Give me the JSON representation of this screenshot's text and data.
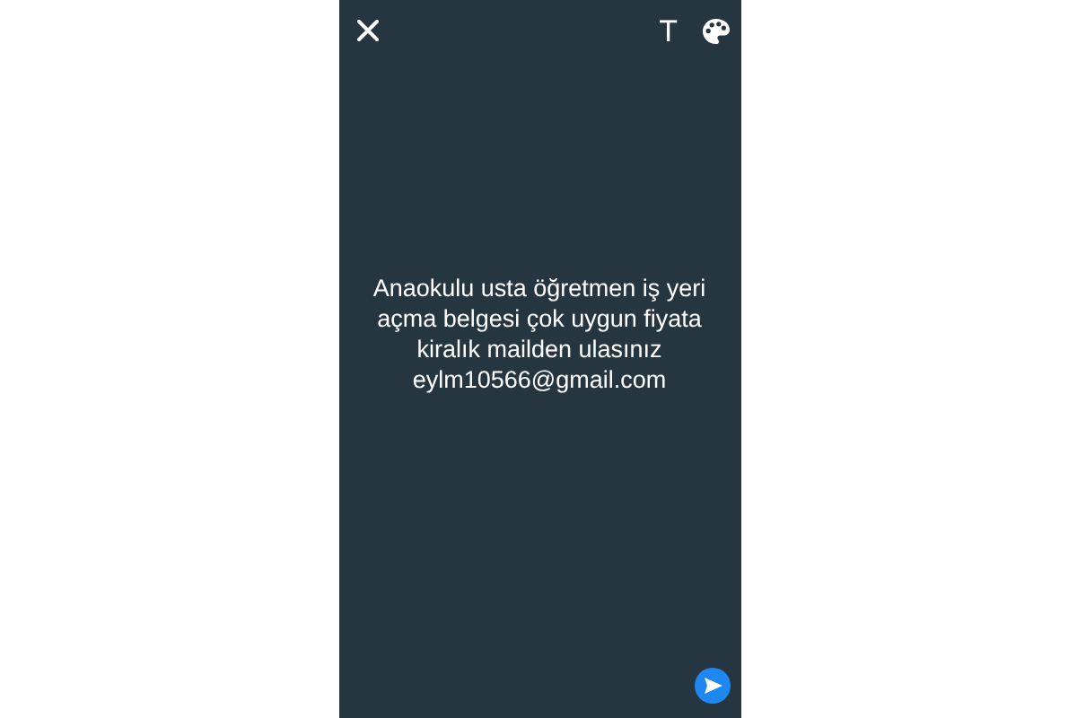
{
  "toolbar": {
    "text_tool": "T"
  },
  "story": {
    "message": "Anaokulu usta öğretmen iş yeri\naçma belgesi çok uygun fiyata\nkiralık mailden ulasınız\neylm10566@gmail.com"
  }
}
